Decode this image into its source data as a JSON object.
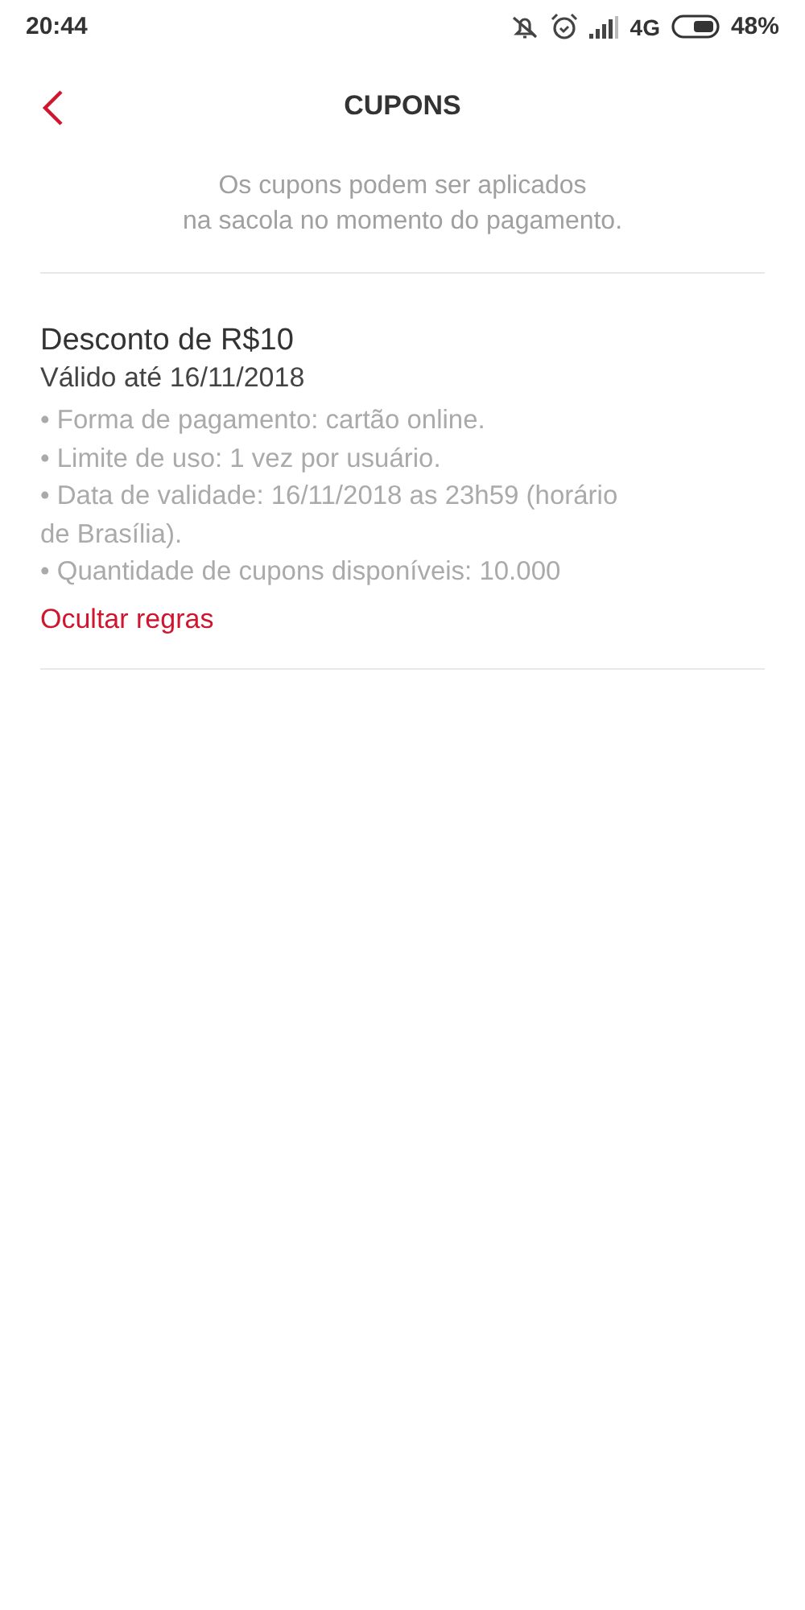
{
  "status_bar": {
    "time": "20:44",
    "network": "4G",
    "battery_text": "48%"
  },
  "header": {
    "title": "CUPONS"
  },
  "intro": "Os cupons podem ser aplicados\nna sacola no momento do pagamento.",
  "coupons": [
    {
      "title": "Desconto de R$10",
      "validity": "Válido até 16/11/2018",
      "expanded": true,
      "rules": [
        "• Forma de pagamento: cartão online.",
        "• Limite de uso: 1 vez por usuário.",
        "• Data de validade: 16/11/2018 as 23h59 (horário de Brasília).",
        "• Quantidade de cupons disponíveis: 10.000"
      ],
      "toggle": "Ocultar regras"
    }
  ]
}
